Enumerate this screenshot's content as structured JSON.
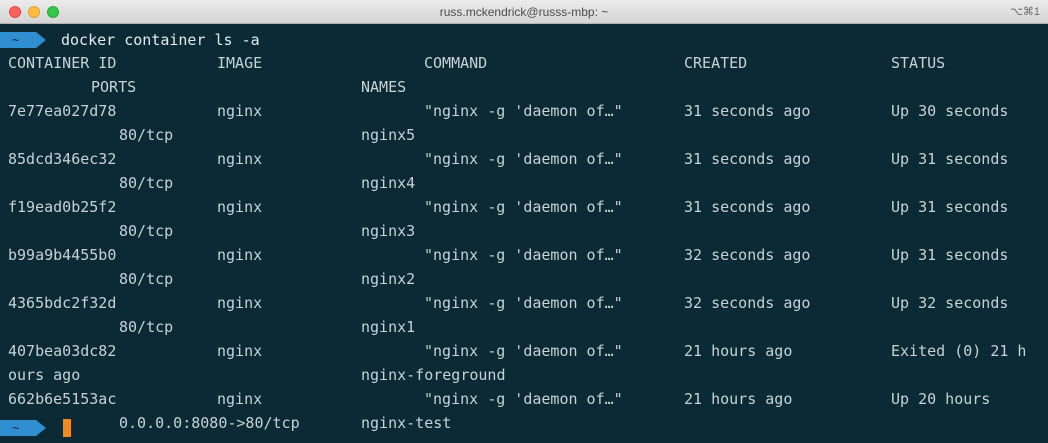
{
  "window": {
    "title": "russ.mckendrick@russs-mbp: ~",
    "shortcut": "⌥⌘1"
  },
  "prompt": {
    "symbol": "~",
    "command": "docker container ls -a"
  },
  "table": {
    "headers": {
      "container_id": "CONTAINER ID",
      "image": "IMAGE",
      "command": "COMMAND",
      "created": "CREATED",
      "status": "STATUS",
      "ports": "PORTS",
      "names": "NAMES"
    },
    "rows": [
      {
        "id": "7e77ea027d78",
        "image": "nginx",
        "command": "\"nginx -g 'daemon of…\"",
        "created": "31 seconds ago",
        "status": "Up 30 seconds",
        "ports": "80/tcp",
        "names": "nginx5"
      },
      {
        "id": "85dcd346ec32",
        "image": "nginx",
        "command": "\"nginx -g 'daemon of…\"",
        "created": "31 seconds ago",
        "status": "Up 31 seconds",
        "ports": "80/tcp",
        "names": "nginx4"
      },
      {
        "id": "f19ead0b25f2",
        "image": "nginx",
        "command": "\"nginx -g 'daemon of…\"",
        "created": "31 seconds ago",
        "status": "Up 31 seconds",
        "ports": "80/tcp",
        "names": "nginx3"
      },
      {
        "id": "b99a9b4455b0",
        "image": "nginx",
        "command": "\"nginx -g 'daemon of…\"",
        "created": "32 seconds ago",
        "status": "Up 31 seconds",
        "ports": "80/tcp",
        "names": "nginx2"
      },
      {
        "id": "4365bdc2f32d",
        "image": "nginx",
        "command": "\"nginx -g 'daemon of…\"",
        "created": "32 seconds ago",
        "status": "Up 32 seconds",
        "ports": "80/tcp",
        "names": "nginx1"
      },
      {
        "id": "407bea03dc82",
        "image": "nginx",
        "command": "\"nginx -g 'daemon of…\"",
        "created": "21 hours ago",
        "status": "Exited (0) 21 h",
        "ports": "ours ago",
        "names": "nginx-foreground"
      },
      {
        "id": "662b6e5153ac",
        "image": "nginx",
        "command": "\"nginx -g 'daemon of…\"",
        "created": "21 hours ago",
        "status": "Up 20 hours",
        "ports": "0.0.0.0:8080->80/tcp",
        "names": "nginx-test"
      }
    ]
  },
  "colors": {
    "background": "#0b2a36",
    "text": "#c7d2d6",
    "prompt_badge": "#2f8fd0",
    "cursor": "#f08a1e"
  },
  "icons": {
    "prompt": "chevron-right-badge",
    "cursor": "block-cursor"
  }
}
